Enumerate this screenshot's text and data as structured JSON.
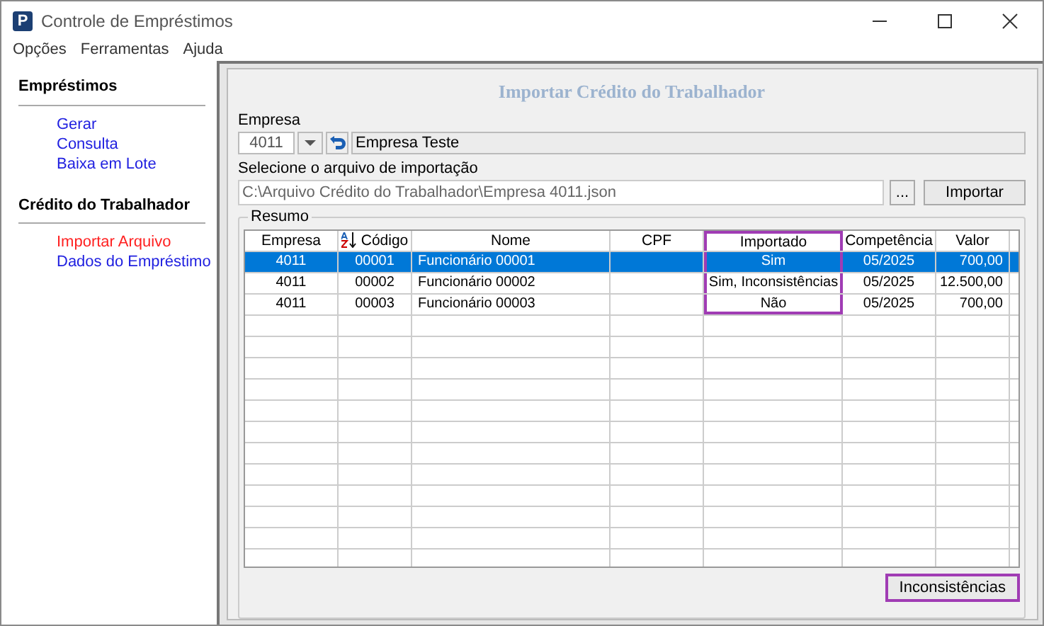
{
  "window": {
    "logo_letter": "P",
    "title": "Controle de Empréstimos"
  },
  "menu": [
    "Opções",
    "Ferramentas",
    "Ajuda"
  ],
  "sidebar": {
    "sections": [
      {
        "title": "Empréstimos",
        "items": [
          {
            "label": "Gerar",
            "selected": false
          },
          {
            "label": "Consulta",
            "selected": false
          },
          {
            "label": "Baixa em Lote",
            "selected": false
          }
        ]
      },
      {
        "title": "Crédito do Trabalhador",
        "items": [
          {
            "label": "Importar Arquivo",
            "selected": true
          },
          {
            "label": "Dados do Empréstimo",
            "selected": false
          }
        ]
      }
    ]
  },
  "panel": {
    "title": "Importar Crédito do Trabalhador",
    "empresa": {
      "label": "Empresa",
      "code": "4011",
      "name": "Empresa Teste"
    },
    "arquivo": {
      "label": "Selecione o arquivo de importação",
      "value": "C:\\Arquivo Crédito do Trabalhador\\Empresa 4011.json",
      "browse": "...",
      "button": "Importar"
    },
    "resumo": {
      "title": "Resumo",
      "columns": [
        {
          "label": "Empresa",
          "sorted": false,
          "highlighted": false
        },
        {
          "label": "Código",
          "sorted": true,
          "highlighted": false
        },
        {
          "label": "Nome",
          "sorted": false,
          "highlighted": false
        },
        {
          "label": "CPF",
          "sorted": false,
          "highlighted": false
        },
        {
          "label": "Importado",
          "sorted": false,
          "highlighted": true
        },
        {
          "label": "Competência",
          "sorted": false,
          "highlighted": false
        },
        {
          "label": "Valor",
          "sorted": false,
          "highlighted": false
        }
      ],
      "rows": [
        {
          "selected": true,
          "cells": [
            "4011",
            "00001",
            "Funcionário 00001",
            "",
            "Sim",
            "05/2025",
            "700,00"
          ]
        },
        {
          "selected": false,
          "cells": [
            "4011",
            "00002",
            "Funcionário 00002",
            "",
            "Sim, Inconsistências",
            "05/2025",
            "12.500,00"
          ]
        },
        {
          "selected": false,
          "cells": [
            "4011",
            "00003",
            "Funcionário 00003",
            "",
            "Não",
            "05/2025",
            "700,00"
          ]
        }
      ],
      "button": {
        "label": "Inconsistências",
        "highlighted": true
      }
    }
  }
}
